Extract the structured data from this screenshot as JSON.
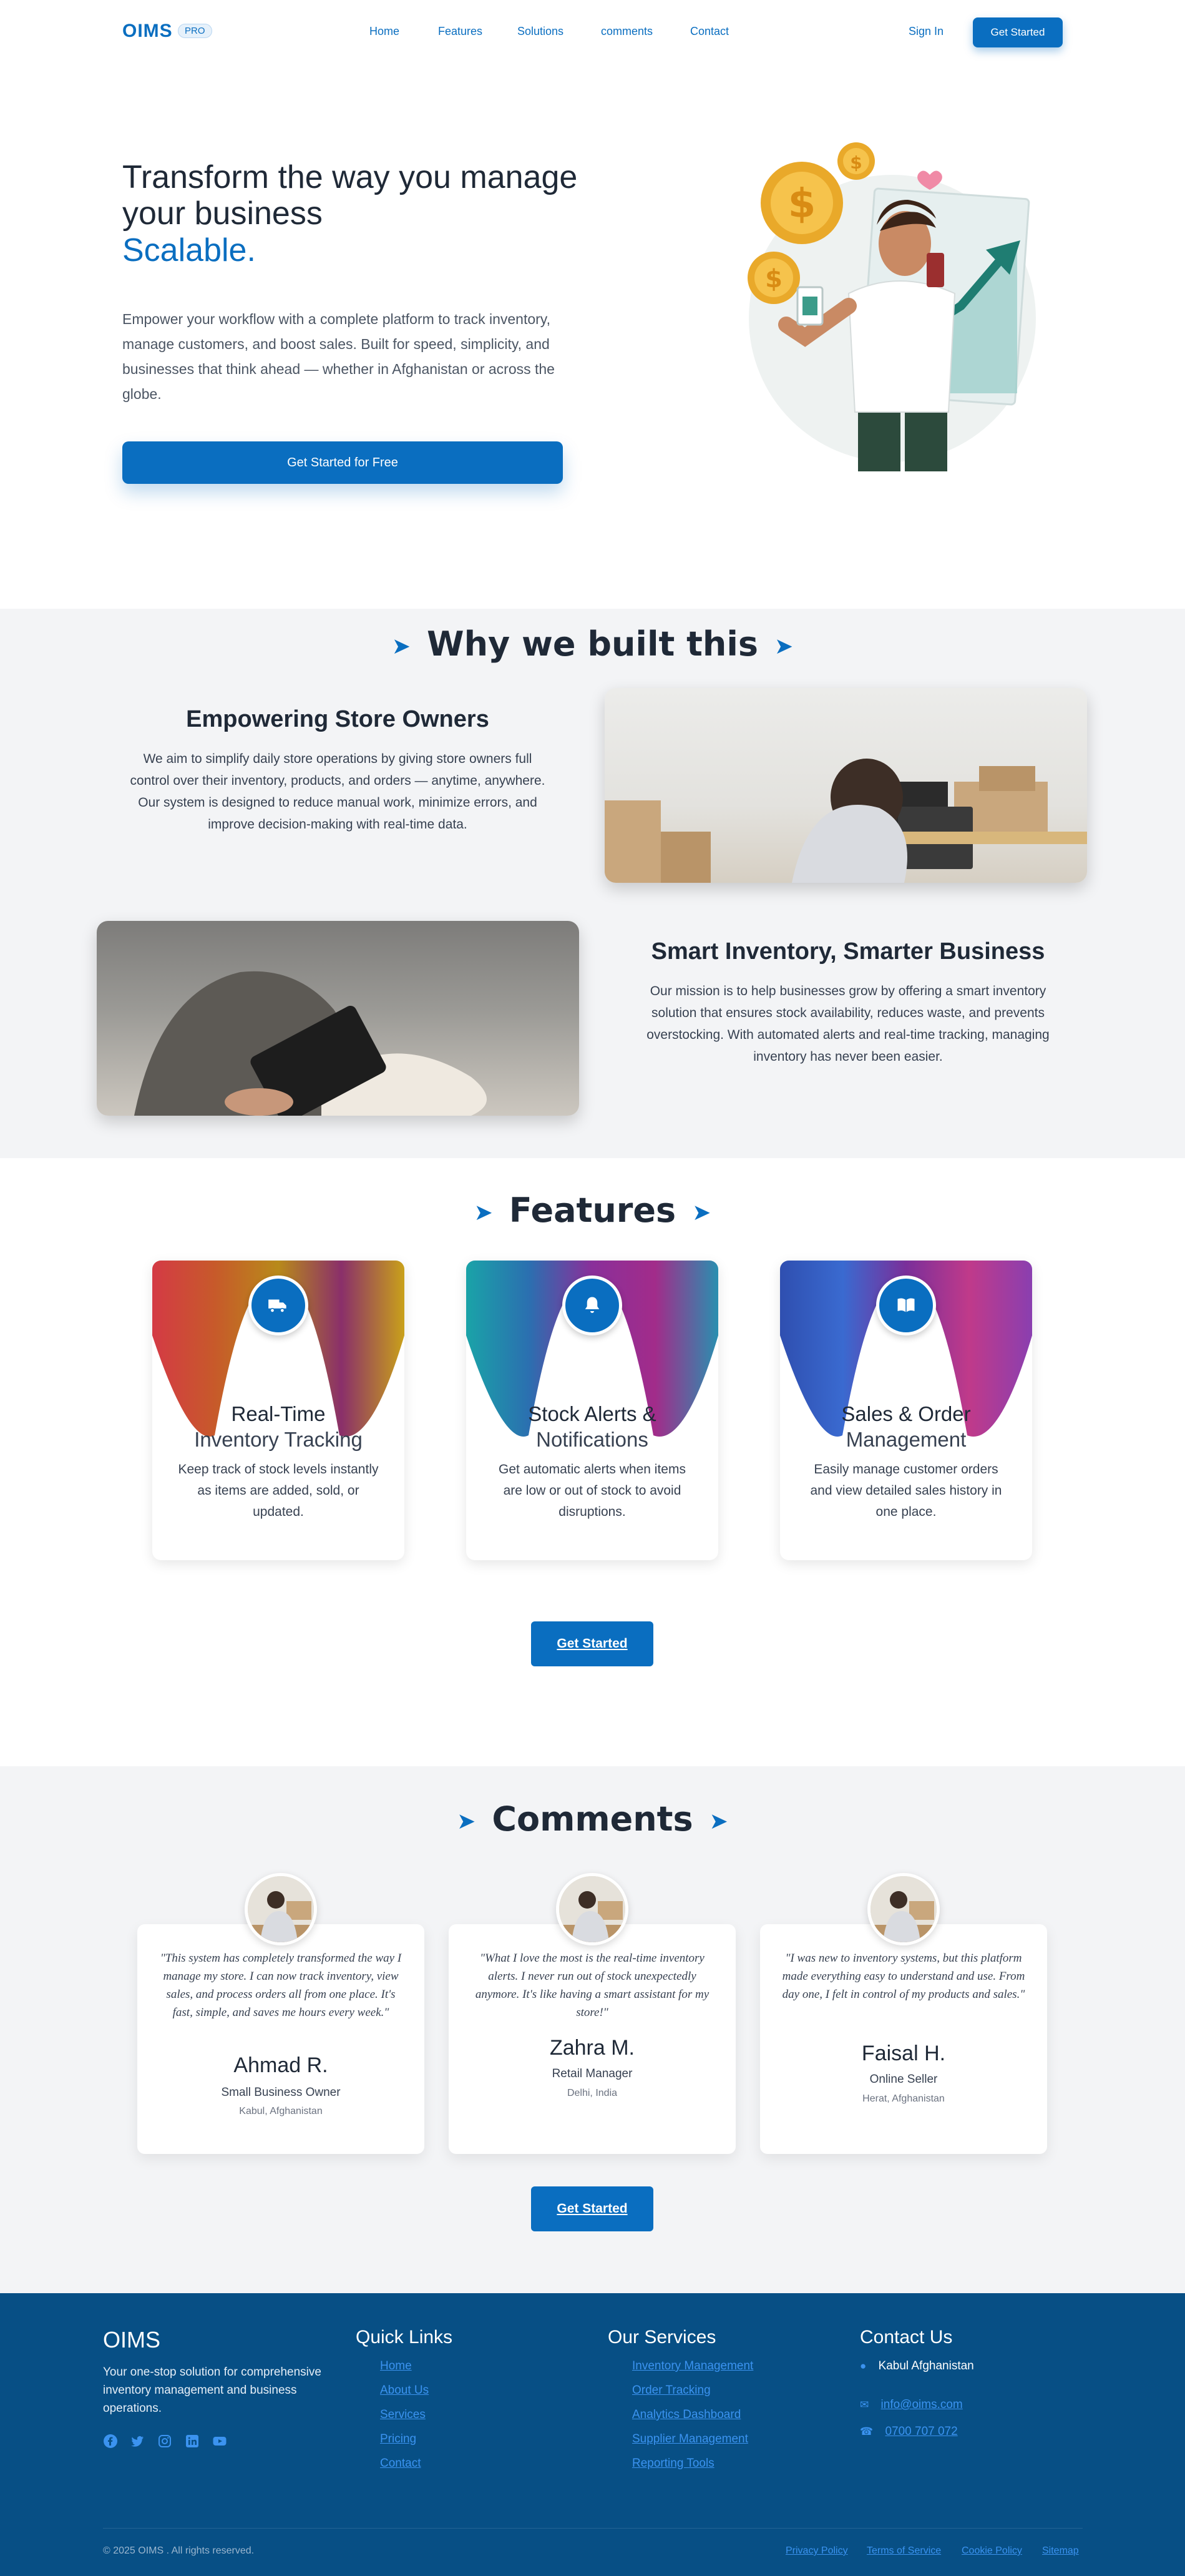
{
  "nav": {
    "logo": "OIMS",
    "badge": "PRO",
    "links": [
      "Home",
      "Features",
      "Solutions",
      "comments",
      "Contact"
    ],
    "signin": "Sign In",
    "cta": "Get Started"
  },
  "hero": {
    "title": "Transform the way you manage your business",
    "accent": "Scalable.",
    "description": "Empower your workflow with a complete platform to track inventory, manage customers, and boost sales. Built for speed, simplicity, and businesses that think ahead — whether in Afghanistan or across the globe.",
    "cta": "Get Started for Free"
  },
  "why": {
    "title": "Why we built this",
    "block1": {
      "heading": "Empowering Store Owners",
      "text": "We aim to simplify daily store operations by giving store owners full control over their inventory, products, and orders — anytime, anywhere. Our system is designed to reduce manual work, minimize errors, and improve decision-making with real-time data."
    },
    "block2": {
      "heading": "Smart Inventory, Smarter Business",
      "text": "Our mission is to help businesses grow by offering a smart inventory solution that ensures stock availability, reduces waste, and prevents overstocking. With automated alerts and real-time tracking, managing inventory has never been easier."
    }
  },
  "features": {
    "title": "Features",
    "cards": [
      {
        "title1": "Real-Time",
        "title2": "Inventory Tracking",
        "desc": "Keep track of stock levels instantly as items are added, sold, or updated.",
        "icon": "truck-icon"
      },
      {
        "title1": "Stock Alerts &",
        "title2": "Notifications",
        "desc": "Get automatic alerts when items are low or out of stock to avoid disruptions.",
        "icon": "bell-icon"
      },
      {
        "title1": "Sales & Order",
        "title2": "Management",
        "desc": "Easily manage customer orders and view detailed sales history in one place.",
        "icon": "book-icon"
      }
    ],
    "cta": "Get Started"
  },
  "comments": {
    "title": "Comments",
    "items": [
      {
        "quote": "\"This system has completely transformed the way I manage my store. I can now track inventory, view sales, and process orders all from one place. It's fast, simple, and saves me hours every week.\"",
        "name": "Ahmad R.",
        "role": "Small Business Owner",
        "location": "Kabul, Afghanistan"
      },
      {
        "quote": "\"What I love the most is the real-time inventory alerts. I never run out of stock unexpectedly anymore. It's like having a smart assistant for my store!\"",
        "name": "Zahra M.",
        "role": "Retail Manager",
        "location": "Delhi, India"
      },
      {
        "quote": "\"I was new to inventory systems, but this platform made everything easy to understand and use. From day one, I felt in control of my products and sales.\"",
        "name": "Faisal H.",
        "role": "Online Seller",
        "location": "Herat, Afghanistan"
      }
    ],
    "cta": "Get Started"
  },
  "footer": {
    "brand": "OIMS",
    "tagline": "Your one-stop solution for comprehensive inventory management and business operations.",
    "quick_links_title": "Quick Links",
    "quick_links": [
      "Home",
      "About Us",
      "Services",
      "Pricing",
      "Contact"
    ],
    "services_title": "Our Services",
    "services": [
      "Inventory Management",
      "Order Tracking",
      "Analytics Dashboard",
      "Supplier Management",
      "Reporting Tools"
    ],
    "contact_title": "Contact Us",
    "address": "Kabul Afghanistan",
    "email": "info@oims.com",
    "phone": "0700 707 072",
    "copyright": "© 2025 OIMS . All rights reserved.",
    "legal": [
      "Privacy Policy",
      "Terms of Service",
      "Cookie Policy",
      "Sitemap"
    ]
  },
  "colors": {
    "brand": "#0a6ec0",
    "footer": "#074f85",
    "section_bg": "#f3f4f6"
  }
}
